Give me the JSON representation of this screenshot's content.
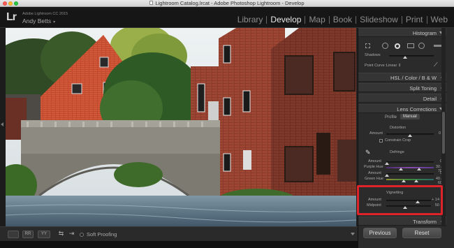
{
  "window": {
    "title": "Lightroom Catalog.lrcat - Adobe Photoshop Lightroom - Develop"
  },
  "identity": {
    "logo": "Lr",
    "product": "Adobe Lightroom CC 2015",
    "user": "Andy Betts"
  },
  "modules": [
    "Library",
    "Develop",
    "Map",
    "Book",
    "Slideshow",
    "Print",
    "Web"
  ],
  "active_module": "Develop",
  "toolbar": {
    "soft_proofing": "Soft Proofing",
    "view_btn_1": "",
    "view_btn_2": "RR",
    "view_btn_3": "YY"
  },
  "panels": {
    "histogram": "Histogram",
    "tone": {
      "shadows": "Shadows",
      "point_curve_label": "Point Curve :",
      "point_curve_value": "Linear"
    },
    "hsl": {
      "hsl": "HSL",
      "color": "Color",
      "bw": "B & W"
    },
    "split_toning": "Split Toning",
    "detail": "Detail",
    "lens_corrections": {
      "title": "Lens Corrections",
      "tabs": [
        "Profile",
        "Manual"
      ],
      "distortion": {
        "heading": "Distortion",
        "amount_label": "Amount",
        "amount_value": "0",
        "constrain_crop": "Constrain Crop"
      },
      "defringe": {
        "heading": "Defringe",
        "rows": [
          {
            "label": "Amount",
            "value": "0"
          },
          {
            "label": "Purple Hue",
            "value": "30 / 70"
          },
          {
            "label": "Amount",
            "value": "0"
          },
          {
            "label": "Green Hue",
            "value": "40 / 60"
          }
        ]
      },
      "vignetting": {
        "heading": "Vignetting",
        "amount_label": "Amount",
        "amount_value": "+ 14",
        "midpoint_label": "Midpoint",
        "midpoint_value": "50"
      }
    },
    "transform": "Transform"
  },
  "buttons": {
    "previous": "Previous",
    "reset": "Reset"
  },
  "colors": {
    "highlight": "#e0232a",
    "active_module": "#e8e8e8",
    "inactive_module": "#8d8d8d"
  }
}
